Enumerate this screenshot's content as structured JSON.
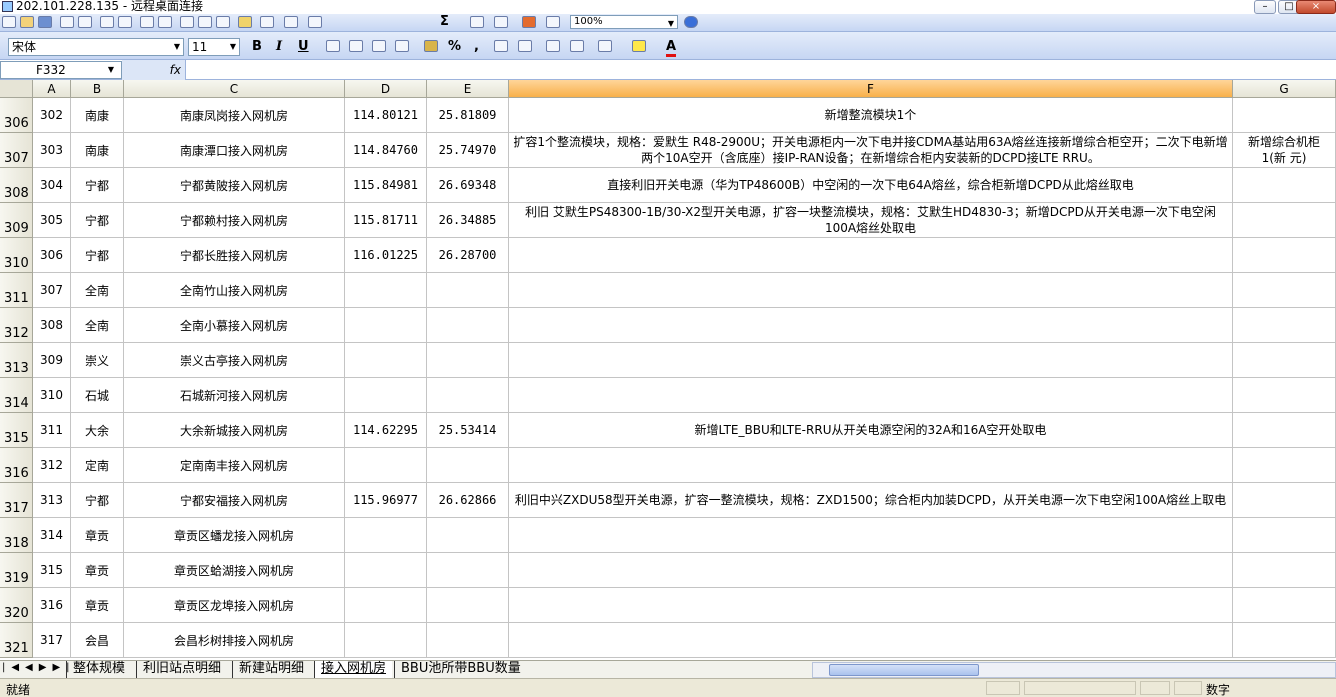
{
  "window": {
    "title": "202.101.228.135 - 远程桌面连接"
  },
  "toolbar": {
    "font_name": "宋体",
    "font_size": "11",
    "bold": "B",
    "italic": "I",
    "underline": "U",
    "percent": "%",
    "comma": ",",
    "zoom": "100%",
    "sigma": "Σ",
    "font_color_label": "A"
  },
  "formula_bar": {
    "name_box": "F332",
    "fx": "fx"
  },
  "columns": [
    "A",
    "B",
    "C",
    "D",
    "E",
    "F",
    "G"
  ],
  "rows": [
    {
      "rownum": "306",
      "a": "302",
      "b": "南康",
      "c": "南康凤岗接入网机房",
      "d": "114.80121",
      "e": "25.81809",
      "f": "新增整流模块1个",
      "g": ""
    },
    {
      "rownum": "307",
      "a": "303",
      "b": "南康",
      "c": "南康潭口接入网机房",
      "d": "114.84760",
      "e": "25.74970",
      "f": "扩容1个整流模块，规格：爱默生 R48-2900U；开关电源柜内一次下电并接CDMA基站用63A熔丝连接新增综合柜空开；二次下电新增两个10A空开（含底座）接IP-RAN设备；在新增综合柜内安装新的DCPD接LTE RRU。",
      "g": "新增综合机柜1(新 元)"
    },
    {
      "rownum": "308",
      "a": "304",
      "b": "宁都",
      "c": "宁都黄陂接入网机房",
      "d": "115.84981",
      "e": "26.69348",
      "f": "直接利旧开关电源（华为TP48600B）中空闲的一次下电64A熔丝，综合柜新增DCPD从此熔丝取电",
      "g": ""
    },
    {
      "rownum": "309",
      "a": "305",
      "b": "宁都",
      "c": "宁都赖村接入网机房",
      "d": "115.81711",
      "e": "26.34885",
      "f": "利旧 艾默生PS48300-1B/30-X2型开关电源，扩容一块整流模块，规格：艾默生HD4830-3；新增DCPD从开关电源一次下电空闲100A熔丝处取电",
      "g": ""
    },
    {
      "rownum": "310",
      "a": "306",
      "b": "宁都",
      "c": "宁都长胜接入网机房",
      "d": "116.01225",
      "e": "26.28700",
      "f": "",
      "g": ""
    },
    {
      "rownum": "311",
      "a": "307",
      "b": "全南",
      "c": "全南竹山接入网机房",
      "d": "",
      "e": "",
      "f": "",
      "g": ""
    },
    {
      "rownum": "312",
      "a": "308",
      "b": "全南",
      "c": "全南小慕接入网机房",
      "d": "",
      "e": "",
      "f": "",
      "g": ""
    },
    {
      "rownum": "313",
      "a": "309",
      "b": "崇义",
      "c": "崇义古亭接入网机房",
      "d": "",
      "e": "",
      "f": "",
      "g": ""
    },
    {
      "rownum": "314",
      "a": "310",
      "b": "石城",
      "c": "石城新河接入网机房",
      "d": "",
      "e": "",
      "f": "",
      "g": ""
    },
    {
      "rownum": "315",
      "a": "311",
      "b": "大余",
      "c": "大余新城接入网机房",
      "d": "114.62295",
      "e": "25.53414",
      "f": "新增LTE_BBU和LTE-RRU从开关电源空闲的32A和16A空开处取电",
      "g": ""
    },
    {
      "rownum": "316",
      "a": "312",
      "b": "定南",
      "c": "定南南丰接入网机房",
      "d": "",
      "e": "",
      "f": "",
      "g": ""
    },
    {
      "rownum": "317",
      "a": "313",
      "b": "宁都",
      "c": "宁都安福接入网机房",
      "d": "115.96977",
      "e": "26.62866",
      "f": "利旧中兴ZXDU58型开关电源，扩容一整流模块，规格：ZXD1500；综合柜内加装DCPD，从开关电源一次下电空闲100A熔丝上取电",
      "g": ""
    },
    {
      "rownum": "318",
      "a": "314",
      "b": "章贡",
      "c": "章贡区蟠龙接入网机房",
      "d": "",
      "e": "",
      "f": "",
      "g": ""
    },
    {
      "rownum": "319",
      "a": "315",
      "b": "章贡",
      "c": "章贡区蛤湖接入网机房",
      "d": "",
      "e": "",
      "f": "",
      "g": ""
    },
    {
      "rownum": "320",
      "a": "316",
      "b": "章贡",
      "c": "章贡区龙埠接入网机房",
      "d": "",
      "e": "",
      "f": "",
      "g": ""
    },
    {
      "rownum": "321",
      "a": "317",
      "b": "会昌",
      "c": "会昌杉树排接入网机房",
      "d": "",
      "e": "",
      "f": "",
      "g": ""
    }
  ],
  "sheet_tabs": [
    "整体规模",
    "利旧站点明细",
    "新建站明细",
    "接入网机房",
    "BBU池所带BBU数量"
  ],
  "active_tab": "接入网机房",
  "status": {
    "ready": "就绪",
    "mode": "数字"
  }
}
